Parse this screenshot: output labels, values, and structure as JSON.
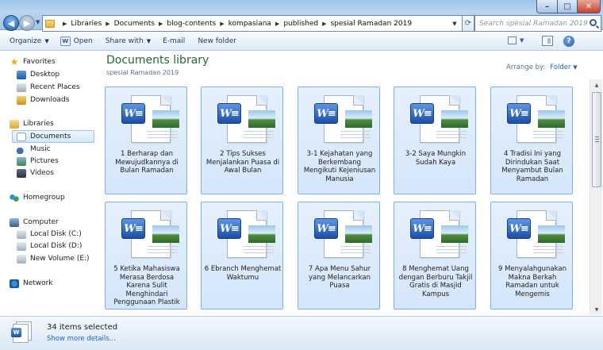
{
  "window": {
    "title_controls": {
      "minimize": "–",
      "maximize": "□",
      "close": "✕"
    }
  },
  "address_bar": {
    "breadcrumb": [
      "Libraries",
      "Documents",
      "blog-contents",
      "kompasiana",
      "published",
      "spesial Ramadan 2019"
    ]
  },
  "search": {
    "placeholder": "Search spesial Ramadan 2019"
  },
  "command_bar": {
    "organize": "Organize",
    "open": "Open",
    "share_with": "Share with",
    "email": "E-mail",
    "new_folder": "New folder"
  },
  "nav_pane": {
    "favorites": "Favorites",
    "desktop": "Desktop",
    "recent_places": "Recent Places",
    "downloads": "Downloads",
    "libraries": "Libraries",
    "documents": "Documents",
    "music": "Music",
    "pictures": "Pictures",
    "videos": "Videos",
    "homegroup": "Homegroup",
    "computer": "Computer",
    "local_disk_c": "Local Disk (C:)",
    "local_disk_d": "Local Disk (D:)",
    "new_volume_e": "New Volume (E:)",
    "network": "Network"
  },
  "content": {
    "library_title": "Documents library",
    "library_subtitle": "spesial Ramadan 2019",
    "arrange_label": "Arrange by:",
    "arrange_value": "Folder",
    "files": [
      "1 Berharap dan Mewujudkannya di Bulan Ramadan",
      "2 Tips Sukses Menjalankan Puasa di Awal Bulan",
      "3-1 Kejahatan yang Berkembang Mengikuti Kejeniusan Manusia",
      "3-2 Saya Mungkin Sudah Kaya",
      "4 Tradisi Ini yang Dirindukan Saat Menyambut Bulan Ramadan",
      "5 Ketika Mahasiswa Merasa Berdosa Karena Sulit Menghindari Penggunaan Plastik",
      "6 Ebranch Menghemat Waktumu",
      "7 Apa Menu Sahur yang Melancarkan Puasa",
      "8 Menghemat Uang dengan Berburu Takjil Gratis di Masjid Kampus",
      "9 Menyalahgunakan Makna Berkah Ramadan untuk Mengemis"
    ],
    "file_icon_letter": "W≡"
  },
  "details_pane": {
    "selected_count": "34 items selected",
    "more_details": "Show more details..."
  }
}
